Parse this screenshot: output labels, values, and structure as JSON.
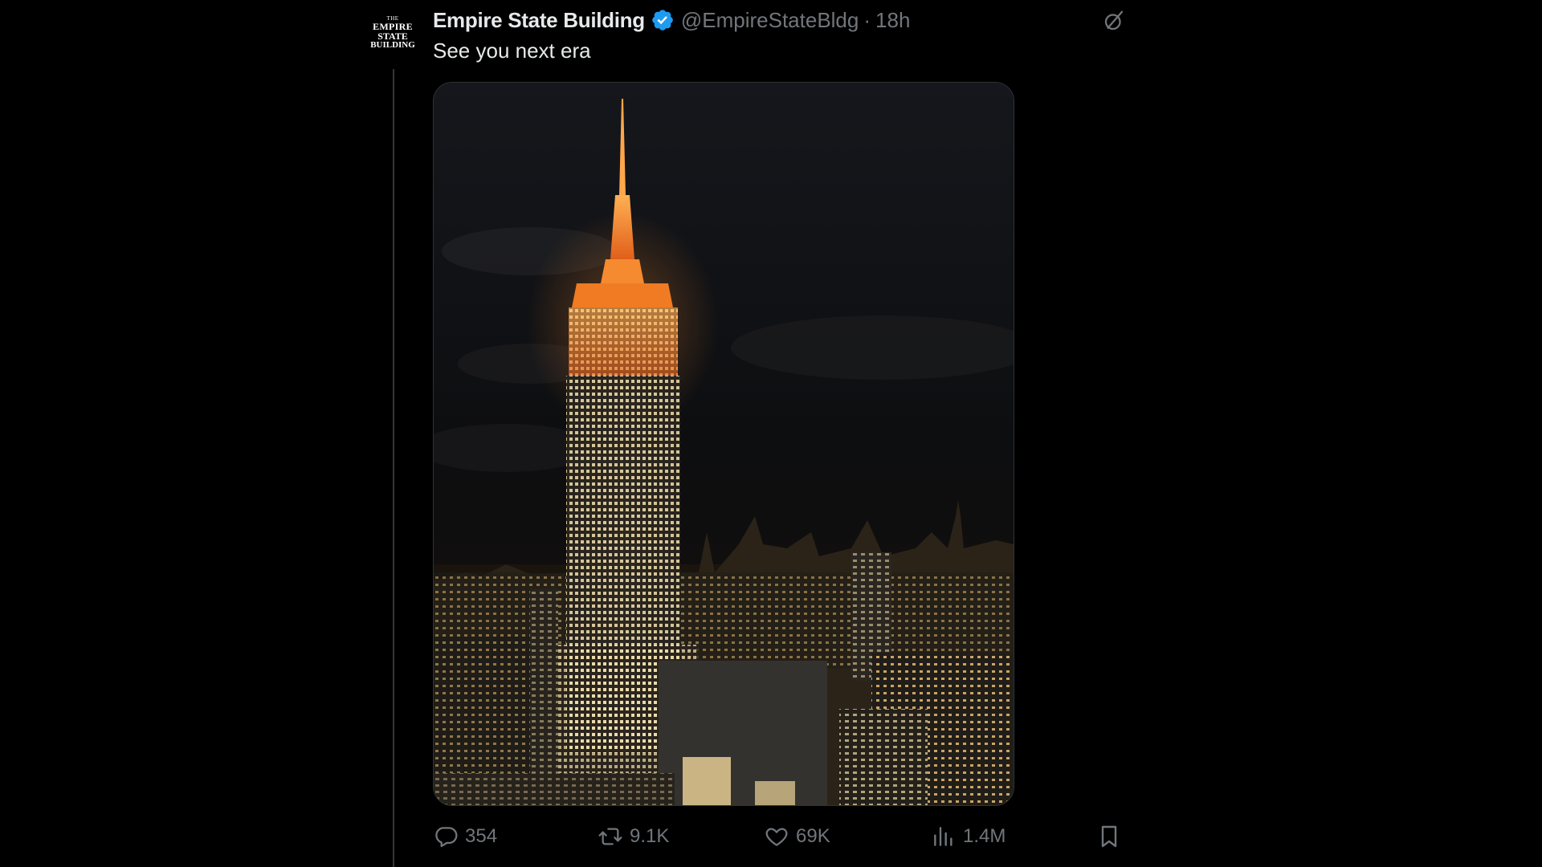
{
  "tweet": {
    "avatar_text": [
      "THE",
      "EMPIRE",
      "STATE",
      "BUILDING"
    ],
    "display_name": "Empire State Building",
    "handle": "@EmpireStateBldg",
    "separator": "·",
    "time": "18h",
    "text": "See you next era",
    "verified_color": "#1d9bf0"
  },
  "actions": {
    "replies": "354",
    "reposts": "9.1K",
    "likes": "69K",
    "views": "1.4M"
  },
  "icons": [
    "grok-icon",
    "verified-badge-icon",
    "reply-icon",
    "repost-icon",
    "like-icon",
    "views-icon",
    "bookmark-icon"
  ],
  "colors": {
    "background": "#000000",
    "text": "#e7e9ea",
    "secondary": "#71767b",
    "building_glow": "#f07b22"
  }
}
